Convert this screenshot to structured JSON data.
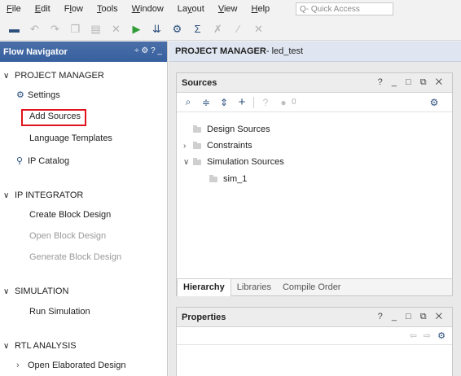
{
  "menu": {
    "items": [
      {
        "pre": "",
        "u": "F",
        "post": "ile",
        "name": "menu-file"
      },
      {
        "pre": "",
        "u": "E",
        "post": "dit",
        "name": "menu-edit"
      },
      {
        "pre": "F",
        "u": "l",
        "post": "ow",
        "name": "menu-flow"
      },
      {
        "pre": "",
        "u": "T",
        "post": "ools",
        "name": "menu-tools"
      },
      {
        "pre": "",
        "u": "W",
        "post": "indow",
        "name": "menu-window"
      },
      {
        "pre": "La",
        "u": "y",
        "post": "out",
        "name": "menu-layout"
      },
      {
        "pre": "",
        "u": "V",
        "post": "iew",
        "name": "menu-view"
      },
      {
        "pre": "",
        "u": "H",
        "post": "elp",
        "name": "menu-help"
      }
    ],
    "quick_access_placeholder": "Q- Quick Access"
  },
  "flow_navigator": {
    "title": "Flow Navigator",
    "header_icons": "÷ ⚙ ? _",
    "project_manager": "PROJECT MANAGER",
    "settings": "Settings",
    "add_sources": "Add Sources",
    "language_templates": "Language Templates",
    "ip_catalog": "IP Catalog",
    "ip_integrator": "IP INTEGRATOR",
    "create_block_design": "Create Block Design",
    "open_block_design": "Open Block Design",
    "generate_block_design": "Generate Block Design",
    "simulation": "SIMULATION",
    "run_simulation": "Run Simulation",
    "rtl_analysis": "RTL ANALYSIS",
    "open_elaborated_design": "Open Elaborated Design"
  },
  "project_manager": {
    "label": "PROJECT MANAGER",
    "project_name": " - led_test"
  },
  "sources": {
    "title": "Sources",
    "controls": "? _ □ ⧉ ✕",
    "badge_count": "0",
    "tree": {
      "design_sources": "Design Sources",
      "constraints": "Constraints",
      "simulation_sources": "Simulation Sources",
      "sim_1": "sim_1"
    },
    "tabs": [
      "Hierarchy",
      "Libraries",
      "Compile Order"
    ]
  },
  "properties": {
    "title": "Properties",
    "controls": "? _ □ ⧉ ✕"
  }
}
